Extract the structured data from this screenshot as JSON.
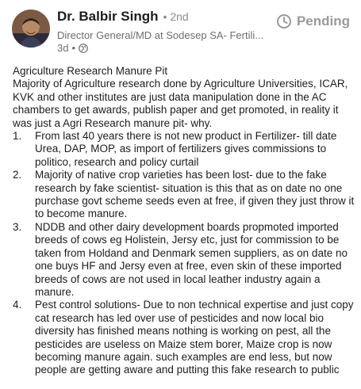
{
  "author": {
    "name": "Dr. Balbir Singh",
    "degree": "• 2nd",
    "headline": "Director General/MD at Sodesep SA- Fertili...",
    "time": "3d",
    "visibility_icon": "globe-icon"
  },
  "status": {
    "label": "Pending",
    "icon": "clock-icon"
  },
  "post": {
    "title": "Agriculture Research Manure Pit",
    "intro": "Majority of Agriculture research done by Agriculture Universities, ICAR, KVK and other institutes are just data manipulation done in the AC chambers to get awards, publish paper and get promoted, in reality it was just a Agri Research manure pit- why.",
    "items": [
      {
        "num": "1.",
        "text": "From last 40 years there is not new product in Fertilizer- till date Urea, DAP, MOP, as import of fertilizers gives commissions to politico, research and policy curtail"
      },
      {
        "num": "2.",
        "text": "Majority of native crop varieties has been lost- due to the fake research by fake scientist- situation is this that as on date no one purchase govt scheme seeds even at free, if given they just throw it to become manure."
      },
      {
        "num": "3.",
        "text": "NDDB and other dairy development boards propmoted imported breeds of cows eg Holistein, Jersy etc, just for commission to be taken from Holdand and Denmark semen suppliers, as on date no one buys HF and Jersy even at free, even skin of these imported breeds of cows are not used in local leather industry again a manure."
      },
      {
        "num": "4.",
        "text": "Pest control solutions- Due to non technical expertise and just copy cat research has led over use of pesticides and now local bio diversity has finished means nothing is working on pest, all the pesticides are useless on Maize stem borer, Maize crop is now becoming manure again. such examples are end less, but now people are getting aware and putting this fake research to public"
      }
    ]
  }
}
